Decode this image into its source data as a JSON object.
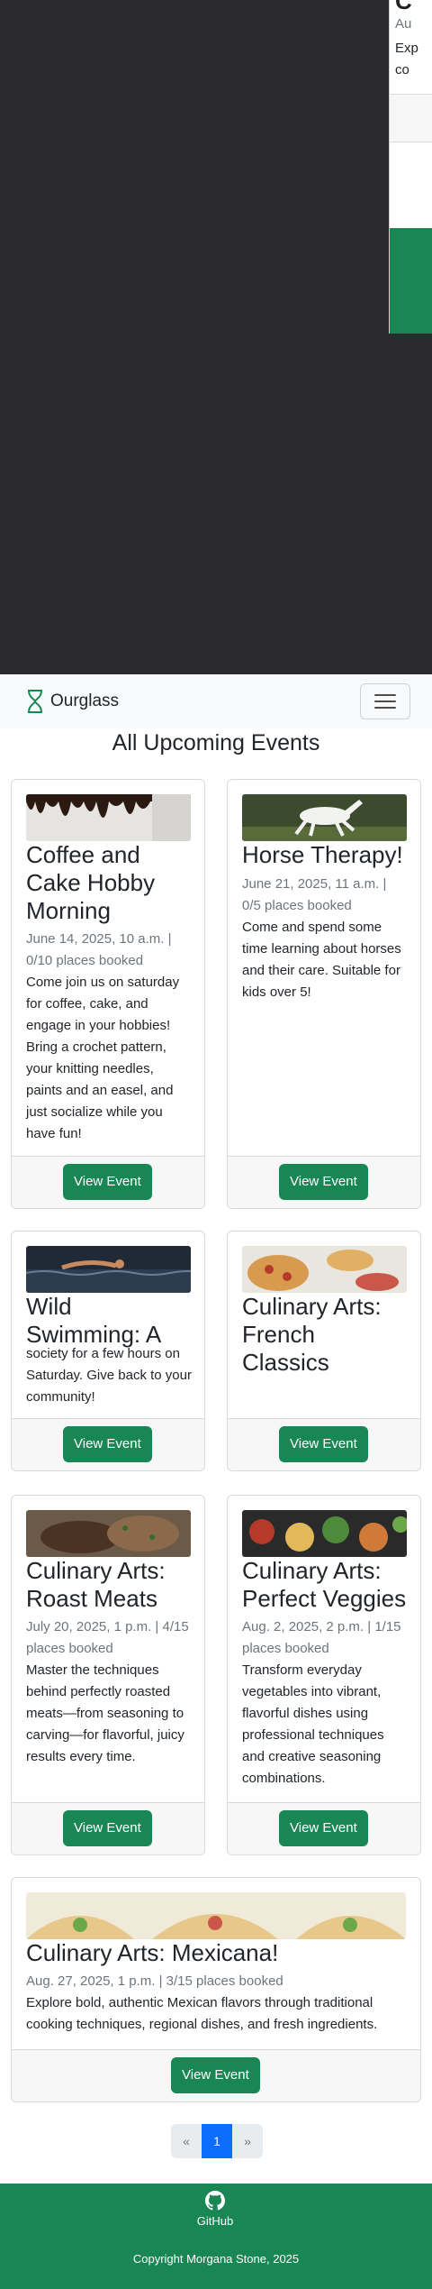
{
  "offcanvas": {
    "title": "C",
    "meta": "Au",
    "text_line1": "Exp",
    "text_line2": "co"
  },
  "navbar": {
    "brand": "Ourglass",
    "toggler_label": "Toggle navigation"
  },
  "page_title": "All Upcoming Events",
  "events": [
    {
      "title": "Coffee and Cake Hobby Morning",
      "meta": "June 14, 2025, 10 a.m. | 0/10 places booked",
      "description": "Come join us on saturday for coffee, cake, and engage in your hobbies! Bring a crochet pattern, your knitting needles, paints and an easel, and just socialize while you have fun!",
      "button": "View Event",
      "image": "cake-image"
    },
    {
      "title": "Horse Therapy!",
      "meta": "June 21, 2025, 11 a.m. | 0/5 places booked",
      "description": "Come and spend some time learning about horses and their care. Suitable for kids over 5!",
      "button": "View Event",
      "image": "horse-image"
    },
    {
      "title": "Wild Swimming: A",
      "meta": "",
      "description": "society for a few hours on Saturday. Give back to your community!",
      "button": "View Event",
      "image": "swimmer-image"
    },
    {
      "title": "Culinary Arts: French Classics",
      "meta": "",
      "description": "",
      "button": "View Event",
      "image": "pizza-image"
    },
    {
      "title": "Culinary Arts: Roast Meats",
      "meta": "July 20, 2025, 1 p.m. | 4/15 places booked",
      "description": "Master the techniques behind perfectly roasted meats—from seasoning to carving—for flavorful, juicy results every time.",
      "button": "View Event",
      "image": "roast-image"
    },
    {
      "title": "Culinary Arts: Perfect Veggies",
      "meta": "Aug. 2, 2025, 2 p.m. | 1/15 places booked",
      "description": "Transform everyday vegetables into vibrant, flavorful dishes using professional techniques and creative seasoning combinations.",
      "button": "View Event",
      "image": "veggies-image"
    },
    {
      "title": "Culinary Arts: Mexicana!",
      "meta": "Aug. 27, 2025, 1 p.m. | 3/15 places booked",
      "description": "Explore bold, authentic Mexican flavors through traditional cooking techniques, regional dishes, and fresh ingredients.",
      "button": "View Event",
      "image": "tacos-image"
    }
  ],
  "pagination": {
    "prev": "«",
    "current": "1",
    "next": "»"
  },
  "footer": {
    "github_label": "GitHub",
    "copyright": "Copyright Morgana Stone, 2025"
  },
  "colors": {
    "primary_green": "#198754",
    "pagination_active": "#0d6efd",
    "overlay": "#2a2a2c"
  }
}
